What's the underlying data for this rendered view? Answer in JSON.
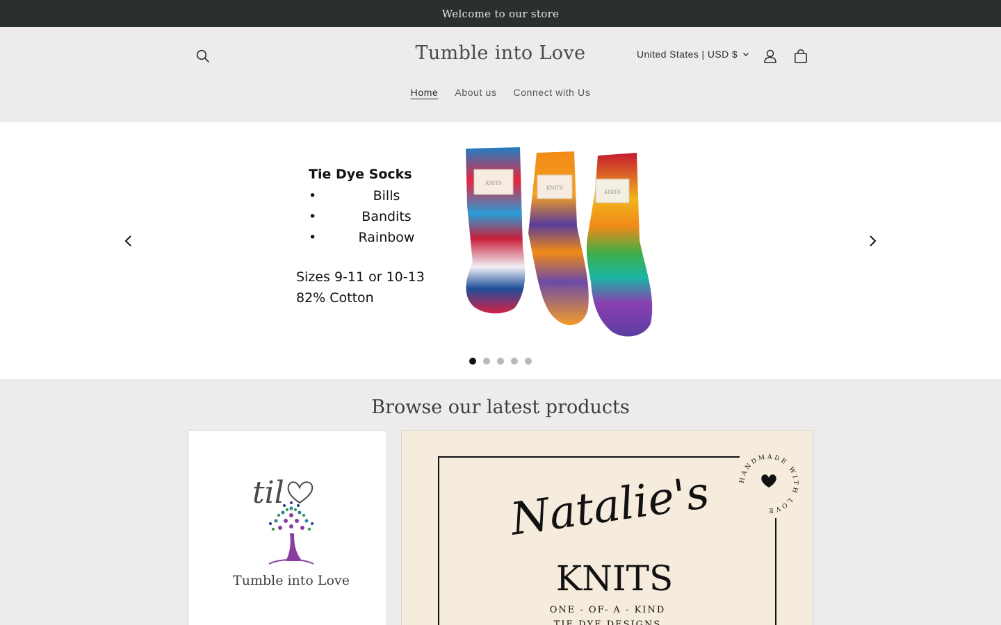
{
  "announcement": {
    "text": "Welcome to our store"
  },
  "header": {
    "store_name": "Tumble into Love",
    "country_selector": "United States | USD $",
    "icons": {
      "search": "search-icon",
      "account": "account-icon",
      "cart": "cart-icon"
    }
  },
  "nav": {
    "items": [
      {
        "label": "Home",
        "active": true
      },
      {
        "label": "About us",
        "active": false
      },
      {
        "label": "Connect with Us",
        "active": false
      }
    ]
  },
  "slideshow": {
    "title": "Tie Dye Socks",
    "items": [
      "Bills",
      "Bandits",
      "Rainbow"
    ],
    "sizes": "Sizes 9-11 or 10-13",
    "material": "82% Cotton",
    "slide_count": 5,
    "active_slide": 1,
    "sock_labels": [
      "KNITS",
      "KNITS",
      "KNITS"
    ]
  },
  "browse": {
    "title": "Browse our latest products",
    "card1": {
      "logo_text": "til",
      "brand": "Tumble into Love"
    },
    "card2": {
      "script_text": "Natalie's",
      "knits_text": "KNITS",
      "tagline": "ONE - OF- A - KIND",
      "tagline2": "TIE DYE DESIGNS",
      "seal_text": "HANDMADE WITH LOVE"
    }
  },
  "colors": {
    "announcement_bg": "#2b302d",
    "header_bg": "#edeceb",
    "hero_bg": "#ffffff",
    "card2_bg": "#f6ecdd"
  }
}
